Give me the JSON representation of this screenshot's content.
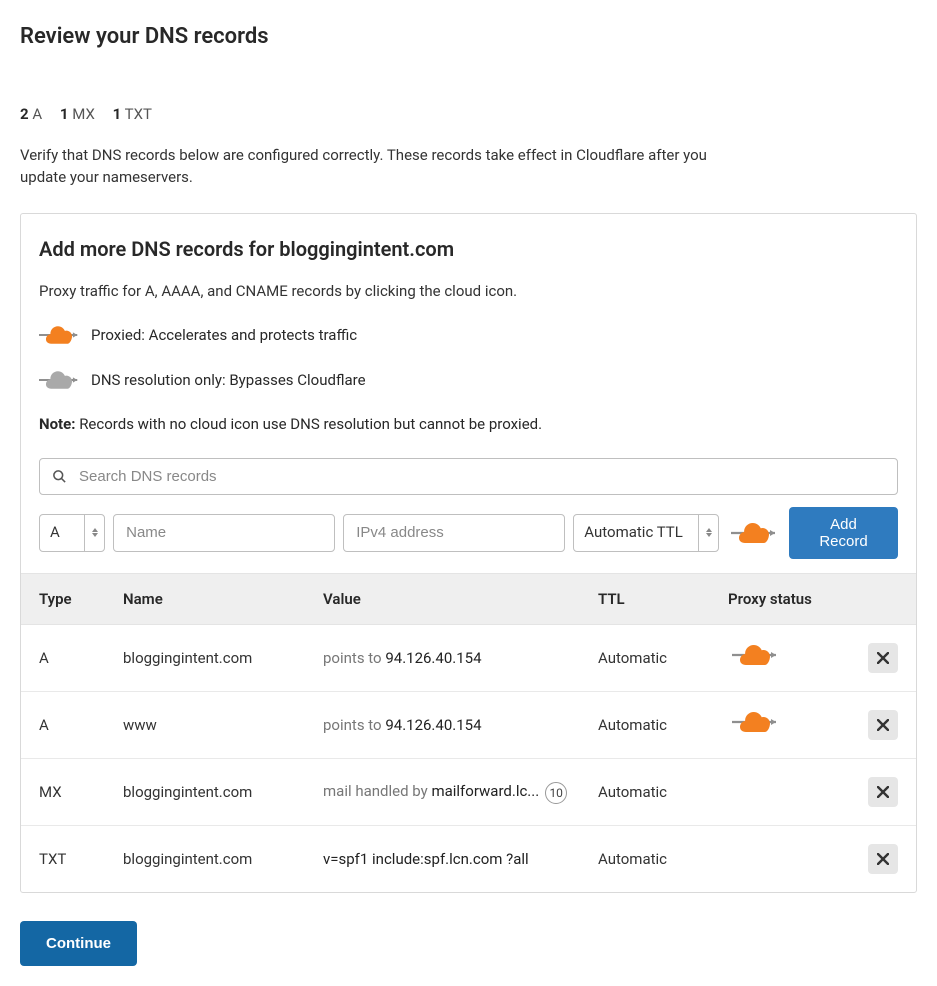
{
  "page_title": "Review your DNS records",
  "summary": [
    {
      "count": "2",
      "type": "A"
    },
    {
      "count": "1",
      "type": "MX"
    },
    {
      "count": "1",
      "type": "TXT"
    }
  ],
  "help_text": "Verify that DNS records below are configured correctly. These records take effect in Cloudflare after you update your nameservers.",
  "panel": {
    "heading": "Add more DNS records for bloggingintent.com",
    "proxy_help": "Proxy traffic for A, AAAA, and CNAME records by clicking the cloud icon.",
    "legend_proxied": "Proxied: Accelerates and protects traffic",
    "legend_dns_only": "DNS resolution only: Bypasses Cloudflare",
    "note_label": "Note:",
    "note_text": "Records with no cloud icon use DNS resolution but cannot be proxied."
  },
  "search_placeholder": "Search DNS records",
  "form": {
    "type_value": "A",
    "name_placeholder": "Name",
    "value_placeholder": "IPv4 address",
    "ttl_value": "Automatic TTL",
    "add_button": "Add Record"
  },
  "table": {
    "headers": {
      "type": "Type",
      "name": "Name",
      "value": "Value",
      "ttl": "TTL",
      "proxy": "Proxy status"
    },
    "rows": [
      {
        "type": "A",
        "name": "bloggingintent.com",
        "prefix": "points to ",
        "value": "94.126.40.154",
        "ttl": "Automatic",
        "proxied": true,
        "has_proxy": true,
        "priority": ""
      },
      {
        "type": "A",
        "name": "www",
        "prefix": "points to ",
        "value": "94.126.40.154",
        "ttl": "Automatic",
        "proxied": true,
        "has_proxy": true,
        "priority": ""
      },
      {
        "type": "MX",
        "name": "bloggingintent.com",
        "prefix": "mail handled by ",
        "value": "mailforward.lc...",
        "ttl": "Automatic",
        "proxied": false,
        "has_proxy": false,
        "priority": "10"
      },
      {
        "type": "TXT",
        "name": "bloggingintent.com",
        "prefix": "",
        "value": "v=spf1 include:spf.lcn.com ?all",
        "ttl": "Automatic",
        "proxied": false,
        "has_proxy": false,
        "priority": ""
      }
    ]
  },
  "continue_button": "Continue",
  "colors": {
    "proxied_orange": "#f38020",
    "dns_grey": "#a9a9a9",
    "primary": "#1467a4",
    "primary_light": "#2f7bbf"
  }
}
